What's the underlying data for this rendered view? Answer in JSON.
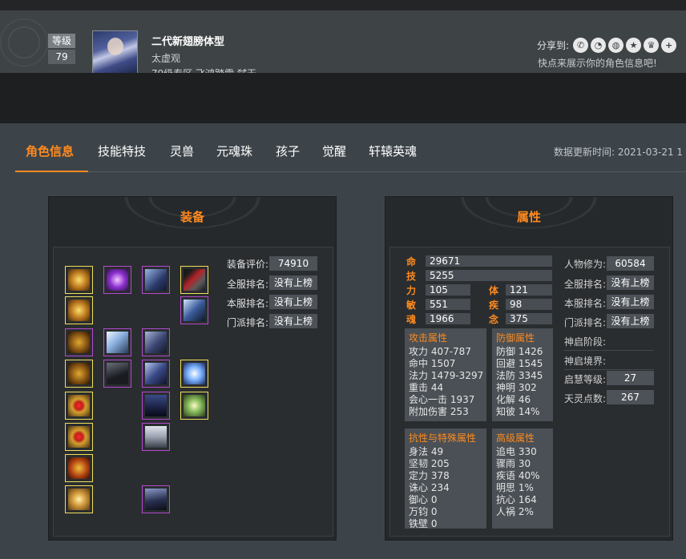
{
  "header": {
    "level_label": "等级",
    "level_value": "79",
    "char_name": "二代新翅膀体型",
    "char_sect": "太虚观",
    "char_server": "79级专区 飞鸿踏雪 弑天",
    "share_label": "分享到:",
    "share_tip": "快点来展示你的角色信息吧!",
    "share_icons": [
      "wechat-icon",
      "qq-icon",
      "weibo-icon",
      "star-icon",
      "crown-icon",
      "plus-icon"
    ]
  },
  "tabs": [
    {
      "label": "角色信息",
      "active": true
    },
    {
      "label": "技能特技"
    },
    {
      "label": "灵兽"
    },
    {
      "label": "元魂珠"
    },
    {
      "label": "孩子"
    },
    {
      "label": "觉醒"
    },
    {
      "label": "轩辕英魂"
    }
  ],
  "update_time": "数据更新时间: 2021-03-21 1",
  "equipment_panel": {
    "title": "装备",
    "rows": [
      {
        "label": "装备评价:",
        "value": "74910"
      },
      {
        "label": "全服排名:",
        "value": "没有上榜"
      },
      {
        "label": "本服排名:",
        "value": "没有上榜"
      },
      {
        "label": "门派排名:",
        "value": "没有上榜"
      }
    ]
  },
  "attr_panel": {
    "title": "属性",
    "main": [
      {
        "key": "命",
        "value": "29671"
      },
      {
        "key": "技",
        "value": "5255"
      }
    ],
    "pairs": [
      {
        "k1": "力",
        "v1": "105",
        "k2": "体",
        "v2": "121"
      },
      {
        "k1": "敏",
        "v1": "551",
        "k2": "疾",
        "v2": "98"
      },
      {
        "k1": "魂",
        "v1": "1966",
        "k2": "念",
        "v2": "375"
      }
    ],
    "attack": {
      "title": "攻击属性",
      "lines": [
        "攻力 407-787",
        "命中 1507",
        "法力 1479-3297",
        "重击 44",
        "会心一击 1937",
        "附加伤害 253"
      ]
    },
    "defense": {
      "title": "防御属性",
      "lines": [
        "防御 1426",
        "回避 1545",
        "法防 3345",
        "神明 302",
        "化解 46",
        "知彼 14%"
      ]
    },
    "resist": {
      "title": "抗性与特殊属性",
      "lines": [
        "身法 49",
        "坚韧 205",
        "定力 378",
        "诛心 234",
        "御心 0",
        "万钧 0",
        "铁壁 0"
      ]
    },
    "advanced": {
      "title": "高级属性",
      "lines": [
        "追电 330",
        "骤雨 30",
        "疾语 40%",
        "明思 1%",
        "抗心 164",
        "人祸 2%"
      ]
    },
    "right": [
      {
        "label": "人物修为:",
        "value": "60584"
      },
      {
        "label": "全服排名:",
        "value": "没有上榜"
      },
      {
        "label": "本服排名:",
        "value": "没有上榜"
      },
      {
        "label": "门派排名:",
        "value": "没有上榜"
      },
      {
        "label": "神启阶段:",
        "value": ""
      },
      {
        "label": "神启境界:",
        "value": ""
      },
      {
        "label": "启慧等级:",
        "value": "27"
      },
      {
        "label": "天灵点数:",
        "value": "267"
      }
    ]
  }
}
